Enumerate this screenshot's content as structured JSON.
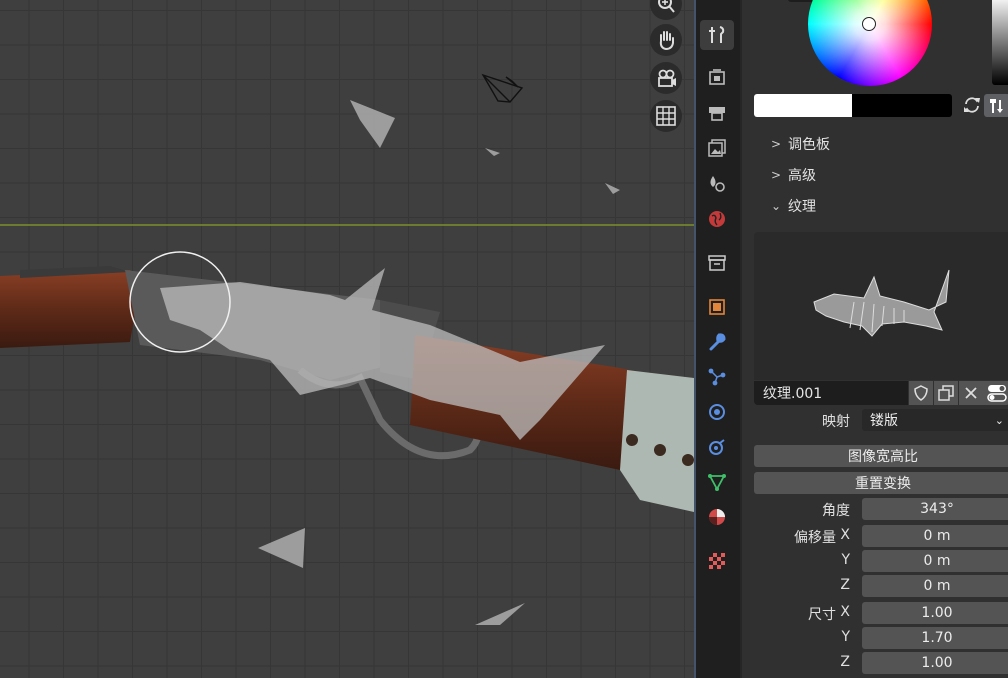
{
  "viewport": {
    "tools": [
      {
        "name": "zoom-icon"
      },
      {
        "name": "hand-pan-icon"
      },
      {
        "name": "camera-view-icon"
      },
      {
        "name": "grid-ortho-icon"
      }
    ]
  },
  "tabs": [
    {
      "name": "tool-icon",
      "active": true
    },
    {
      "name": "render-icon"
    },
    {
      "name": "output-icon"
    },
    {
      "name": "view-layer-icon"
    },
    {
      "name": "scene-icon"
    },
    {
      "name": "world-icon"
    },
    {
      "name": "collection-icon"
    },
    {
      "name": "object-icon"
    },
    {
      "name": "modifier-wrench-icon"
    },
    {
      "name": "particles-icon"
    },
    {
      "name": "physics-icon"
    },
    {
      "name": "constraints-icon"
    },
    {
      "name": "object-data-icon"
    },
    {
      "name": "material-icon"
    },
    {
      "name": "texture-checker-icon"
    }
  ],
  "panel": {
    "sections": {
      "palette": "调色板",
      "advanced": "高级",
      "texture": "纹理"
    },
    "texture_name": "纹理.001",
    "mapping_label": "映射",
    "mapping_value": "镂版",
    "image_aspect_button": "图像宽高比",
    "reset_transform_button": "重置变换",
    "angle_label": "角度",
    "angle_value": "343°",
    "offset_label": "偏移量",
    "offset": {
      "x_label": "X",
      "y_label": "Y",
      "z_label": "Z",
      "x": "0 m",
      "y": "0 m",
      "z": "0 m"
    },
    "size_label": "尺寸",
    "size": {
      "x_label": "X",
      "y_label": "Y",
      "z_label": "Z",
      "x": "1.00",
      "y": "1.70",
      "z": "1.00"
    }
  },
  "colors": {
    "accent_active_tab": "#3d3d3d",
    "x_axis_line": "#7a8f2a",
    "field": "#545454"
  }
}
